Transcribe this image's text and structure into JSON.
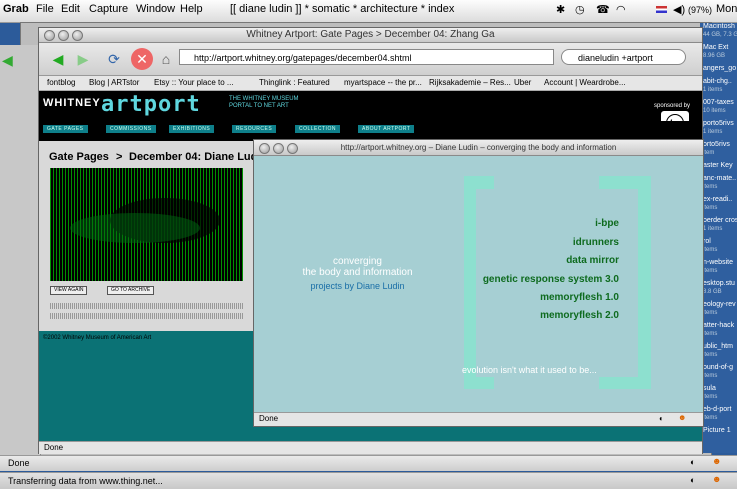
{
  "menubar": {
    "app": "Grab",
    "items": [
      "File",
      "Edit",
      "Capture",
      "Window",
      "Help"
    ],
    "window_title": "[[ diane ludin ]] * somatic * architecture * index",
    "battery": "(97%)",
    "time": "Mon"
  },
  "browser": {
    "title": "Whitney Artport: Gate Pages > December 04: Zhang Ga",
    "url": "http://artport.whitney.org/gatepages/december04.shtml",
    "search": "dianeludin +artport",
    "bookmarks": [
      "fontblog",
      "Blog | ARTstor",
      "Etsy :: Your place to ...",
      "Thinglink : Featured",
      "myartspace -- the pr...",
      "Rijksakademie – Res...",
      "Uber",
      "Account | Weardrobe..."
    ],
    "status": "Done"
  },
  "whitney": {
    "logo_left": "WHITNEY",
    "logo_right": "artport",
    "tagline": "THE WHITNEY MUSEUM PORTAL TO NET ART",
    "sponsor": "sponsored by",
    "hp_sub": "invent",
    "nav": [
      "GATE PAGES",
      "COMMISSIONS",
      "EXHIBITIONS",
      "RESOURCES",
      "COLLECTION",
      "ABOUT ARTPORT"
    ],
    "heading_section": "Gate Pages",
    "heading_title": "December 04: Diane Ludin",
    "btn_view": "VIEW AGAIN",
    "btn_archive": "GO TO ARCHIVE",
    "copyright": "©2002 Whitney Museum of American Art"
  },
  "popup": {
    "title": "http://artport.whitney.org – Diane Ludin – converging the body and information",
    "heading1": "converging",
    "heading2": "the body and information",
    "projects": "projects by Diane Ludin",
    "links": [
      "i-bpe",
      "idrunners",
      "data mirror",
      "genetic response system 3.0",
      "memoryflesh 1.0",
      "memoryflesh 2.0"
    ],
    "tagline": "evolution isn't what it used to be...",
    "status": "Done"
  },
  "desktop": {
    "items": [
      {
        "name": "Macintosh H",
        "meta": "44 GB, 7.3 GB"
      },
      {
        "name": "Mac Ext",
        "meta": "8.96 GB"
      },
      {
        "name": "angers_go",
        "meta": ""
      },
      {
        "name": "abit-chg..",
        "meta": "1 items"
      },
      {
        "name": "007-taxes",
        "meta": "10 items"
      },
      {
        "name": "porto5rivs",
        "meta": "1 items"
      },
      {
        "name": "orto5rivs",
        "meta": "item"
      },
      {
        "name": "aster Key",
        "meta": ""
      },
      {
        "name": "anc-mate..",
        "meta": "items"
      },
      {
        "name": "ex-readi..",
        "meta": "items"
      },
      {
        "name": "oerder cros",
        "meta": "1 items"
      },
      {
        "name": "rol",
        "meta": "items"
      },
      {
        "name": "n-website",
        "meta": "items"
      },
      {
        "name": "esktop.stu",
        "meta": "8.8 GB"
      },
      {
        "name": "eology-rev",
        "meta": "items"
      },
      {
        "name": "atter-hack",
        "meta": "items"
      },
      {
        "name": "ublic_htm",
        "meta": "items"
      },
      {
        "name": "ound-of-g",
        "meta": "items"
      },
      {
        "name": "sula",
        "meta": "items"
      },
      {
        "name": "eb-d-port",
        "meta": "items"
      },
      {
        "name": "Picture 1",
        "meta": ""
      }
    ]
  },
  "finder": {
    "status1": "Done",
    "status2": "Transferring data from www.thing.net..."
  }
}
